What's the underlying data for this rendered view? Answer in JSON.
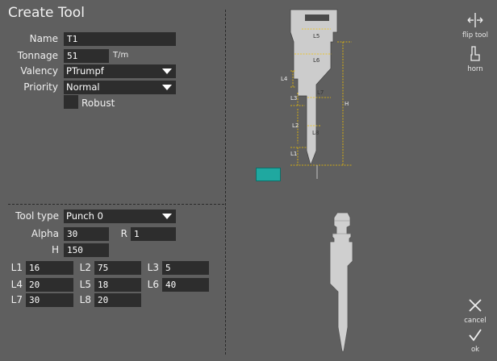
{
  "title": "Create Tool",
  "form": {
    "name": {
      "label": "Name",
      "value": "T1"
    },
    "tonnage": {
      "label": "Tonnage",
      "value": "51",
      "unit": "T/m"
    },
    "valency": {
      "label": "Valency",
      "value": "PTrumpf"
    },
    "priority": {
      "label": "Priority",
      "value": "Normal"
    },
    "robust": {
      "label": "Robust",
      "checked": false
    }
  },
  "params": {
    "tool_type": {
      "label": "Tool type",
      "value": "Punch 0"
    },
    "alpha": {
      "label": "Alpha",
      "value": "30"
    },
    "r": {
      "label": "R",
      "value": "1"
    },
    "h": {
      "label": "H",
      "value": "150"
    },
    "l1": {
      "label": "L1",
      "value": "16"
    },
    "l2": {
      "label": "L2",
      "value": "75"
    },
    "l3": {
      "label": "L3",
      "value": "5"
    },
    "l4": {
      "label": "L4",
      "value": "20"
    },
    "l5": {
      "label": "L5",
      "value": "18"
    },
    "l6": {
      "label": "L6",
      "value": "40"
    },
    "l7": {
      "label": "L7",
      "value": "30"
    },
    "l8": {
      "label": "L8",
      "value": "20"
    }
  },
  "diagram_labels": {
    "l5": "L5",
    "l6": "L6",
    "l4": "L4",
    "l7": "L7",
    "l3": "L3",
    "l2": "L2",
    "l8": "L8",
    "l1": "L1",
    "h": "H"
  },
  "sidebar": {
    "flip": {
      "label": "flip tool",
      "icon": "flip-arrows-icon"
    },
    "horn": {
      "label": "horn",
      "icon": "horn-icon"
    },
    "cancel": {
      "label": "cancel",
      "icon": "x-icon"
    },
    "ok": {
      "label": "ok",
      "icon": "check-icon"
    }
  },
  "colors": {
    "background": "#5f5f5f",
    "field": "#2d2d2d",
    "dimension": "#f2c200",
    "highlight": "#1fa8a0",
    "tool": "#cfcfcf"
  }
}
